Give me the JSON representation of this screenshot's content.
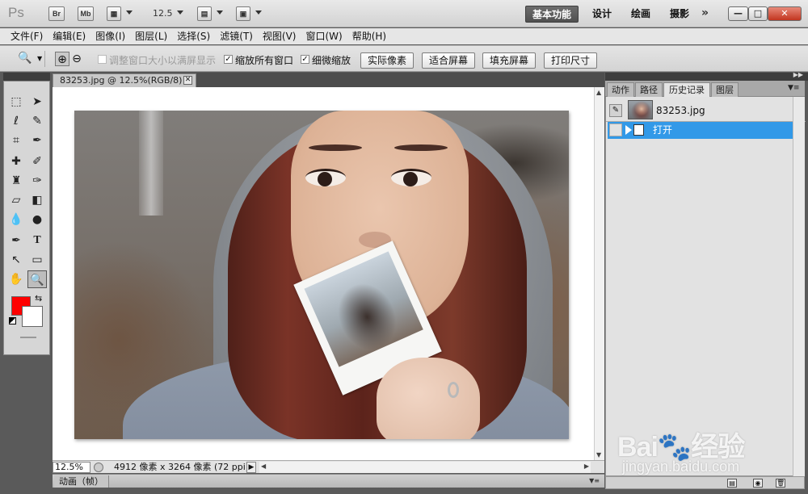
{
  "app": {
    "logo": "Ps",
    "bridge_label": "Br",
    "minibridge_label": "Mb",
    "zoom_level": "12.5",
    "workspaces": [
      "基本功能",
      "设计",
      "绘画",
      "摄影"
    ],
    "more_symbol": "»",
    "window_controls": {
      "minimize": "—",
      "maximize": "□",
      "close": "✕"
    }
  },
  "menu": [
    "文件(F)",
    "编辑(E)",
    "图像(I)",
    "图层(L)",
    "选择(S)",
    "滤镜(T)",
    "视图(V)",
    "窗口(W)",
    "帮助(H)"
  ],
  "options": {
    "tool_icon": "zoom-icon",
    "resize_windows": {
      "label": "调整窗口大小以满屏显示",
      "checked": false
    },
    "zoom_all_windows": {
      "label": "缩放所有窗口",
      "checked": true
    },
    "scrubby_zoom": {
      "label": "细微缩放",
      "checked": true
    },
    "buttons": [
      "实际像素",
      "适合屏幕",
      "填充屏幕",
      "打印尺寸"
    ]
  },
  "colors": {
    "foreground": "#ff0000",
    "background": "#ffffff",
    "history_highlight": "#3299e8",
    "active_workspace": "#5a5a5a"
  },
  "document": {
    "tab_title": "83253.jpg @ 12.5%(RGB/8)",
    "tab_close": "✕"
  },
  "status": {
    "zoom": "12.5%",
    "info": "4912 像素 x 3264 像素 (72 ppi)",
    "timeline_tab": "动画（帧）"
  },
  "panels": {
    "tabs": [
      "动作",
      "路径",
      "历史记录",
      "图层"
    ],
    "active_tab": "历史记录",
    "history": {
      "snapshot_name": "83253.jpg",
      "states": [
        {
          "name": "打开",
          "selected": true
        }
      ]
    }
  },
  "watermark": {
    "logo": "Bai🐾经验",
    "url": "jingyan.baidu.com"
  }
}
